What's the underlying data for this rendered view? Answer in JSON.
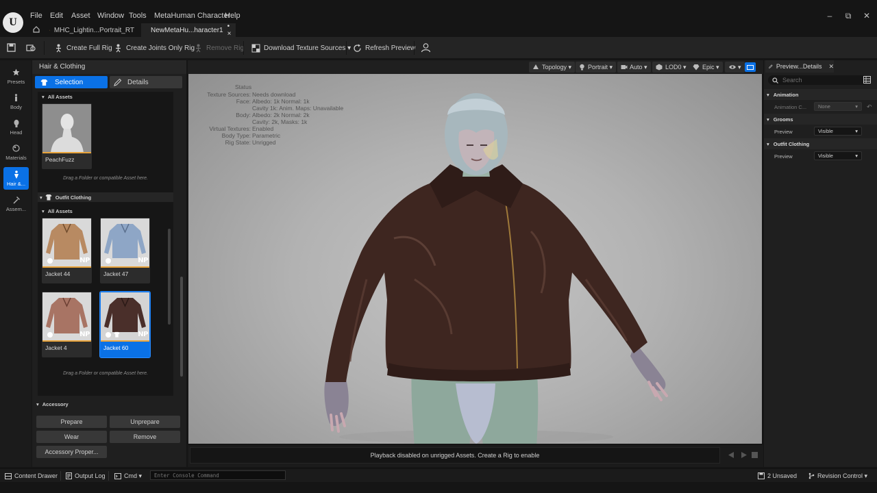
{
  "menu": [
    "File",
    "Edit",
    "Asset",
    "Window",
    "Tools",
    "MetaHuman Character",
    "Help"
  ],
  "tabs": [
    {
      "label": "MHC_Lightin...Portrait_RT"
    },
    {
      "label": "NewMetaHu...haracter1",
      "suffix": "• ×"
    }
  ],
  "window_controls": {
    "minimize": "–",
    "restore": "⧉",
    "close": "✕"
  },
  "toolbar": {
    "create_full_rig": "Create Full Rig",
    "create_joints_rig": "Create Joints Only Rig",
    "remove_rig": "Remove Rig",
    "download_textures": "Download Texture Sources ▾",
    "refresh_preview": "Refresh Preview"
  },
  "leftnav": [
    {
      "label": "Presets",
      "icon": "star-icon"
    },
    {
      "label": "Body",
      "icon": "body-icon"
    },
    {
      "label": "Head",
      "icon": "head-icon"
    },
    {
      "label": "Materials",
      "icon": "materials-icon"
    },
    {
      "label": "Hair &...",
      "icon": "hair-icon",
      "active": true
    },
    {
      "label": "Assem...",
      "icon": "hammer-icon"
    }
  ],
  "panel": {
    "title": "Hair & Clothing",
    "selection_tab": "Selection",
    "details_tab": "Details",
    "all_assets": "All Assets",
    "grooms_asset": "PeachFuzz",
    "drag_hint": "Drag a Folder or compatible Asset here.",
    "outfit_section": "Outfit Clothing",
    "np": "NP",
    "outfits": [
      "Jacket 44",
      "Jacket 47",
      "Jacket 4",
      "Jacket 60"
    ],
    "selected_outfit": "Jacket 60"
  },
  "accessory": {
    "title": "Accessory",
    "prepare": "Prepare",
    "unprepare": "Unprepare",
    "wear": "Wear",
    "remove": "Remove",
    "properties": "Accessory Proper..."
  },
  "viewport_toolbar": {
    "topology": "Topology ▾",
    "portrait": "Portrait ▾",
    "auto": "Auto ▾",
    "lod": "LOD0 ▾",
    "quality": "Epic ▾",
    "view": "▾"
  },
  "status": {
    "heading": "Status",
    "rows": [
      {
        "label": "Texture Sources:",
        "value": "Needs download"
      },
      {
        "label": "Face:",
        "value": "Albedo: 1k Normal: 1k"
      },
      {
        "label": "",
        "value": "Cavity 1k: Anim. Maps: Unavailable"
      },
      {
        "label": "Body:",
        "value": "Albedo: 2k Normal: 2k"
      },
      {
        "label": "",
        "value": "Cavity: 2k, Masks: 1k"
      },
      {
        "label": "Virtual Textures:",
        "value": "Enabled"
      },
      {
        "label": "Body Type:",
        "value": "Parametric"
      },
      {
        "label": "Rig State:",
        "value": "Unrigged"
      }
    ]
  },
  "playback_message": "Playback disabled on unrigged Assets. Create a Rig to enable",
  "details_panel": {
    "tab": "Preview...Details",
    "search_placeholder": "Search",
    "animation_section": "Animation",
    "animation_label": "Animation C...",
    "animation_value": "None",
    "grooms_section": "Grooms",
    "grooms_preview_label": "Preview",
    "grooms_preview_value": "Visible",
    "outfit_section": "Outfit Clothing",
    "outfit_preview_label": "Preview",
    "outfit_preview_value": "Visible"
  },
  "statusbar": {
    "content_drawer": "Content Drawer",
    "output_log": "Output Log",
    "cmd": "Cmd ▾",
    "console_placeholder": "Enter Console Command",
    "unsaved": "2 Unsaved",
    "revision_control": "Revision Control ▾"
  },
  "colors": {
    "accent": "#0a71e6",
    "thumb_underline": "#e8a33a",
    "jacket_brown": "#3e2620"
  }
}
